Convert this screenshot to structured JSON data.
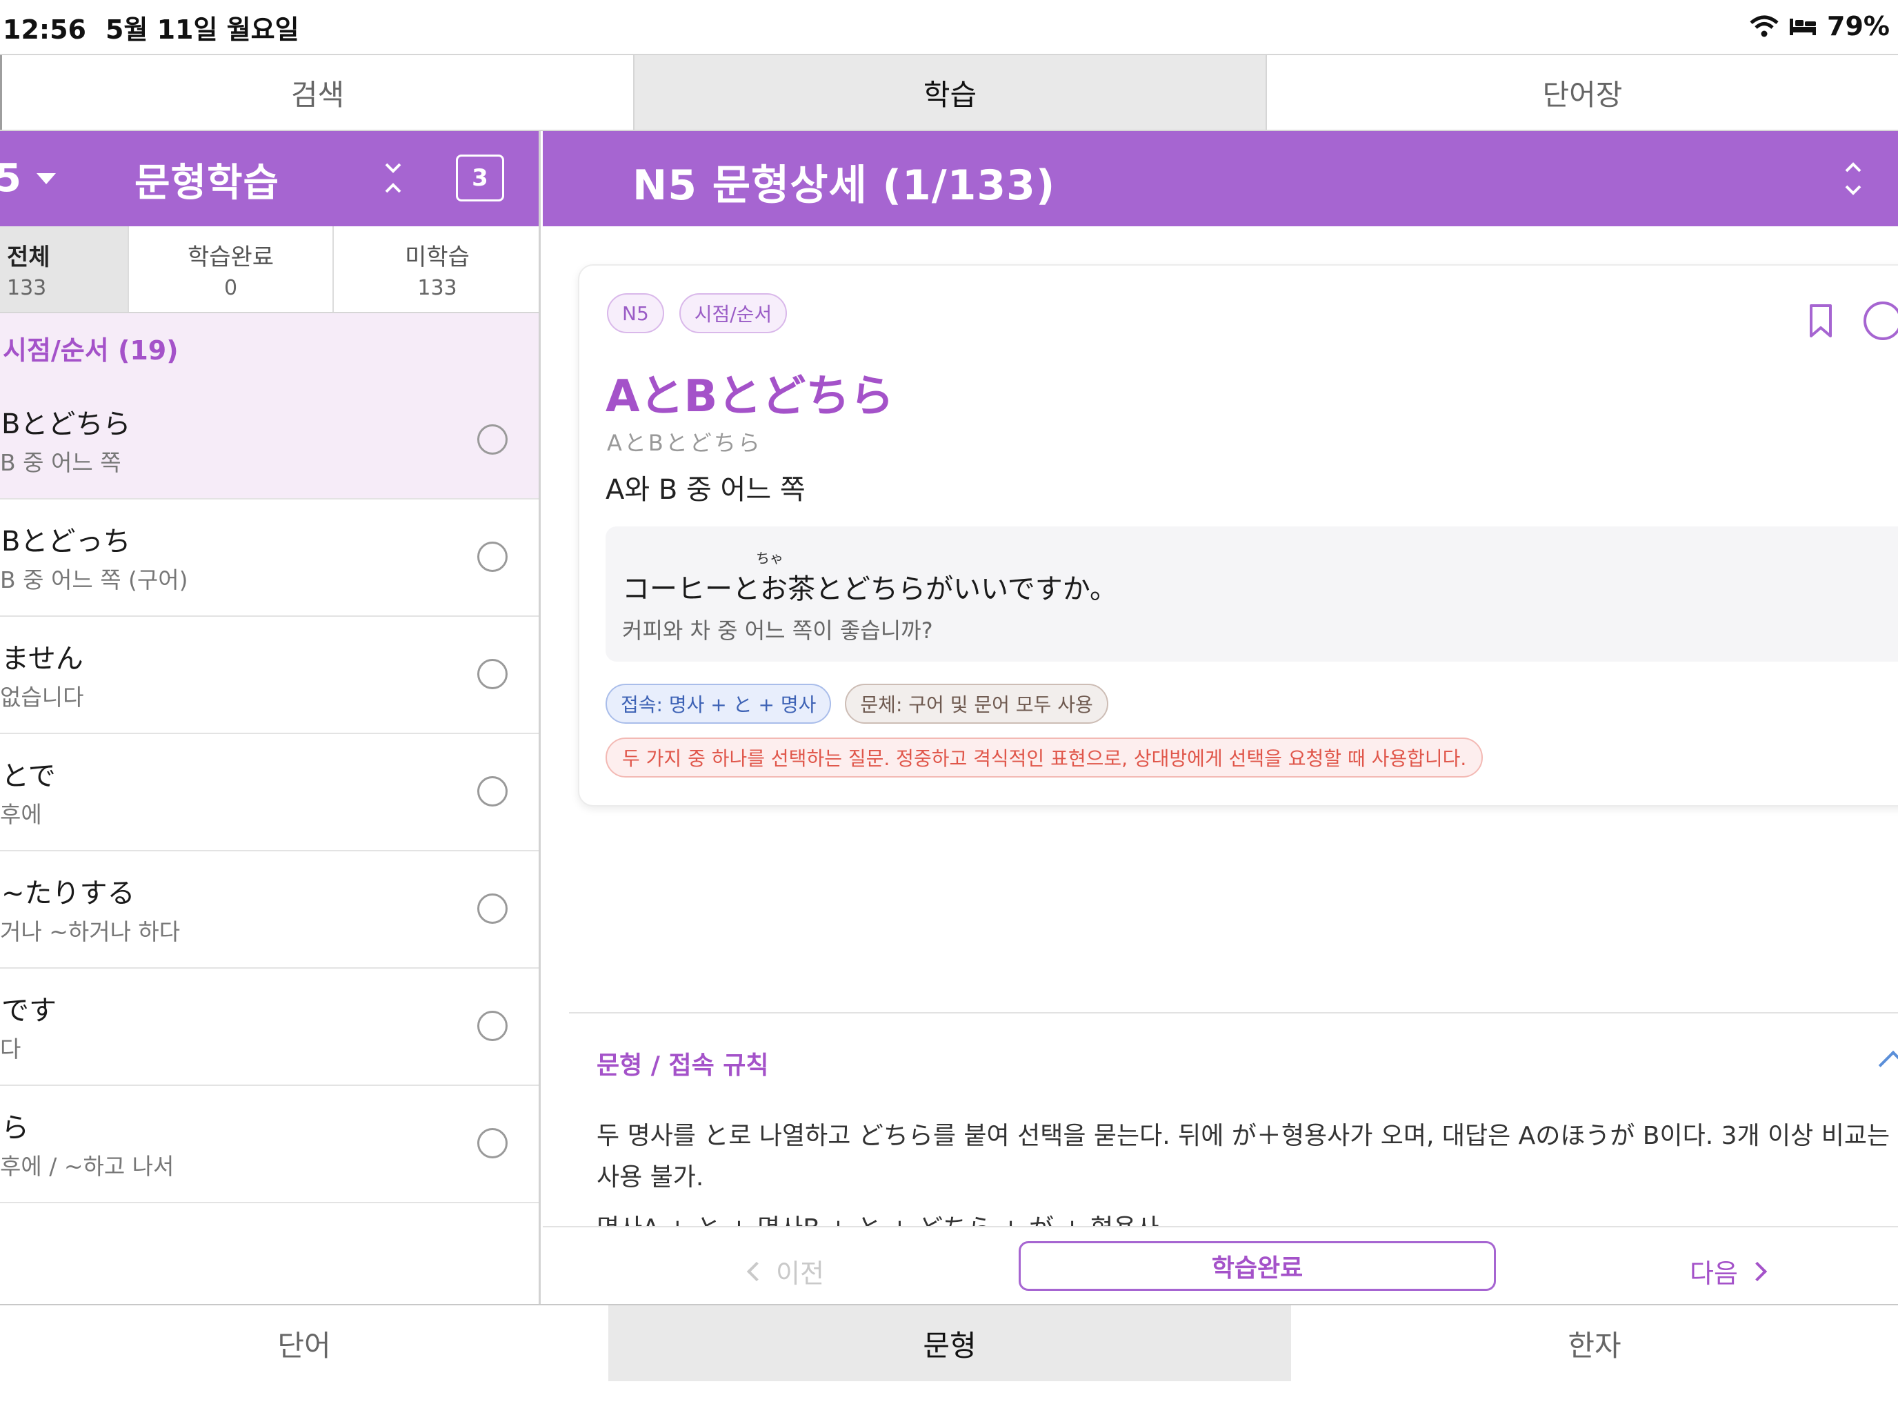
{
  "status_bar": {
    "time": "12:56",
    "date": "5월 11일 월요일",
    "battery": "79%",
    "icons": [
      "wifi-icon",
      "bed-icon"
    ]
  },
  "top_tabs": [
    {
      "label": "검색",
      "active": false
    },
    {
      "label": "학습",
      "active": true
    },
    {
      "label": "단어장",
      "active": false
    }
  ],
  "left_pane": {
    "level_label": "5",
    "title": "문형학습",
    "count_badge": "3",
    "filters": [
      {
        "label": "전체",
        "count": "133",
        "active": true
      },
      {
        "label": "학습완료",
        "count": "0",
        "active": false
      },
      {
        "label": "미학습",
        "count": "133",
        "active": false
      }
    ],
    "section": "시점/순서 (19)",
    "items": [
      {
        "jp": "Bとどちら",
        "ko": "B 중 어느 쪽",
        "selected": true
      },
      {
        "jp": "Bとどっち",
        "ko": "B 중 어느 쪽 (구어)",
        "selected": false
      },
      {
        "jp": "ません",
        "ko": "없습니다",
        "selected": false
      },
      {
        "jp": "とで",
        "ko": "후에",
        "selected": false
      },
      {
        "jp": "~たりする",
        "ko": "거나 ~하거나 하다",
        "selected": false
      },
      {
        "jp": "です",
        "ko": "다",
        "selected": false
      },
      {
        "jp": "ら",
        "ko": "후에 / ~하고 나서",
        "selected": false
      }
    ]
  },
  "detail": {
    "header_title": "N5 문형상세 (1/133)",
    "chips": [
      "N5",
      "시점/순서"
    ],
    "title": "AとBとどちら",
    "reading": "AとBとどちら",
    "meaning": "A와 B 중 어느 쪽",
    "example": {
      "furigana": "ちゃ",
      "jp": "コーヒーとお茶とどちらがいいですか。",
      "ko": "커피와 차 중 어느 쪽이 좋습니까?"
    },
    "tags": {
      "connection": "접속: 명사 + と + 명사",
      "style": "문체: 구어 및 문어 모두 사용"
    },
    "note": "두 가지 중 하나를 선택하는 질문. 정중하고 격식적인 표현으로, 상대방에게 선택을 요청할 때 사용합니다.",
    "rule": {
      "title": "문형 / 접속 규칙",
      "text": "두 명사를 と로 나열하고 どちら를 붙여 선택을 묻는다. 뒤에 が＋형용사가 오며, 대답은 Aのほうが B이다. 3개 이상 비교는 사용 불가.",
      "formula": "명사A + と + 명사B + と + どちら + が + 형용사"
    }
  },
  "nav": {
    "prev": "이전",
    "done": "학습완료",
    "next": "다음"
  },
  "bottom_tabs": [
    {
      "label": "단어",
      "active": false
    },
    {
      "label": "문형",
      "active": true
    },
    {
      "label": "한자",
      "active": false
    }
  ],
  "colors": {
    "accent": "#a665d1",
    "accent_text": "#a452c9",
    "selected_bg": "#f6ecf8",
    "note_red": "#e0564a"
  }
}
